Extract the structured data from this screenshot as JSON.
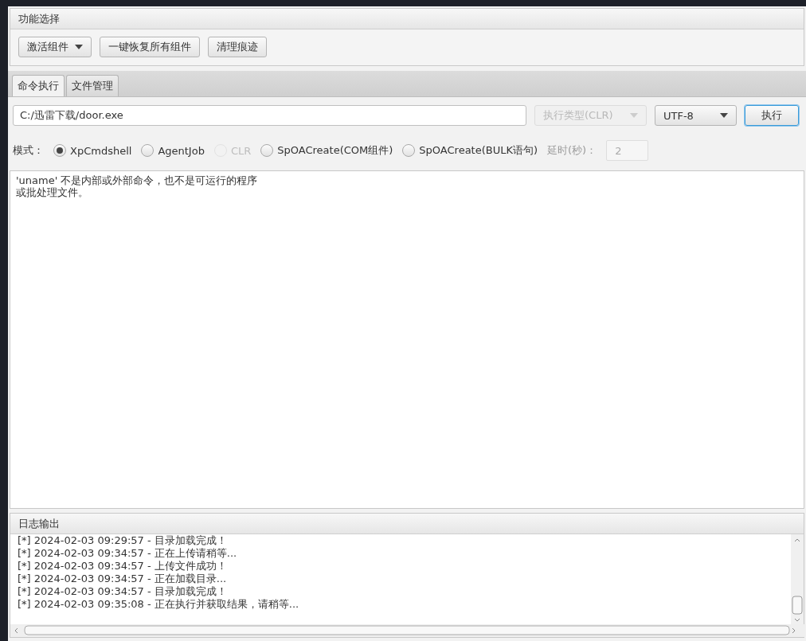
{
  "function_panel": {
    "title": "功能选择",
    "buttons": [
      {
        "label": "激活组件",
        "kind": "menu"
      },
      {
        "label": "一键恢复所有组件",
        "kind": "plain"
      },
      {
        "label": "清理痕迹",
        "kind": "plain"
      }
    ]
  },
  "tabs": [
    {
      "label": "命令执行",
      "selected": true
    },
    {
      "label": "文件管理",
      "selected": false
    }
  ],
  "command": {
    "value": "C:/迅雷下载/door.exe",
    "exec_type": {
      "value": "执行类型(CLR)",
      "disabled": true
    },
    "encoding": {
      "value": "UTF-8",
      "disabled": false
    },
    "run_button": "执行"
  },
  "mode": {
    "label": "模式：",
    "options": [
      {
        "label": "XpCmdshell",
        "selected": true,
        "disabled": false
      },
      {
        "label": "AgentJob",
        "selected": false,
        "disabled": false
      },
      {
        "label": "CLR",
        "selected": false,
        "disabled": true
      },
      {
        "label": "SpOACreate(COM组件)",
        "selected": false,
        "disabled": false
      },
      {
        "label": "SpOACreate(BULK语句)",
        "selected": false,
        "disabled": false
      }
    ],
    "delay_label": "延时(秒)：",
    "delay_value": "2"
  },
  "output": [
    "'uname' 不是内部或外部命令，也不是可运行的程序",
    "或批处理文件。"
  ],
  "log_panel": {
    "title": "日志输出",
    "lines": [
      "[*] 2024-02-03 09:29:57 - 目录加载完成！",
      "[*] 2024-02-03 09:34:57 - 正在上传请稍等...",
      "[*] 2024-02-03 09:34:57 - 上传文件成功！",
      "[*] 2024-02-03 09:34:57 - 正在加载目录...",
      "[*] 2024-02-03 09:34:57 - 目录加载完成！",
      "[*] 2024-02-03 09:35:08 - 正在执行并获取结果，请稍等..."
    ]
  }
}
